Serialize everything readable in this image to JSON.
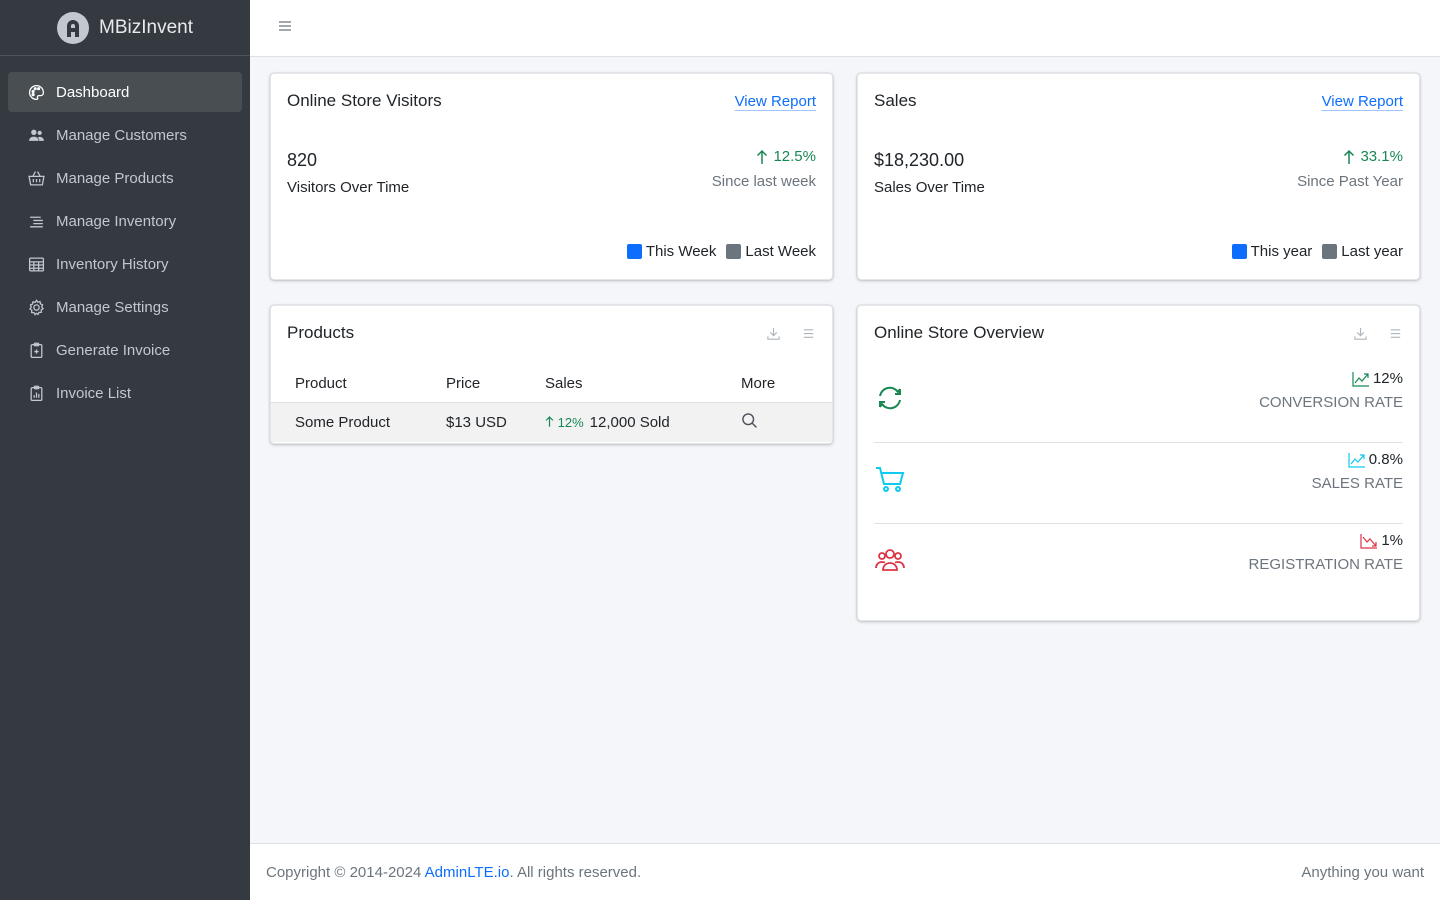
{
  "brand": {
    "name": "MBizInvent"
  },
  "sidebar": {
    "items": [
      {
        "label": "Dashboard",
        "icon": "palette-icon",
        "active": true
      },
      {
        "label": "Manage Customers",
        "icon": "people-icon"
      },
      {
        "label": "Manage Products",
        "icon": "basket-icon"
      },
      {
        "label": "Manage Inventory",
        "icon": "text-indent-icon"
      },
      {
        "label": "Inventory History",
        "icon": "table-icon"
      },
      {
        "label": "Manage Settings",
        "icon": "gear-icon"
      },
      {
        "label": "Generate Invoice",
        "icon": "clipboard-plus-icon"
      },
      {
        "label": "Invoice List",
        "icon": "clipboard-data-icon"
      }
    ]
  },
  "visitors": {
    "title": "Online Store Visitors",
    "link": "View Report",
    "value": "820",
    "label": "Visitors Over Time",
    "change": "12.5%",
    "since": "Since last week",
    "legend": [
      "This Week",
      "Last Week"
    ]
  },
  "sales": {
    "title": "Sales",
    "link": "View Report",
    "value": "$18,230.00",
    "label": "Sales Over Time",
    "change": "33.1%",
    "since": "Since Past Year",
    "legend": [
      "This year",
      "Last year"
    ]
  },
  "products": {
    "title": "Products",
    "columns": [
      "Product",
      "Price",
      "Sales",
      "More"
    ],
    "rows": [
      {
        "product": "Some Product",
        "price": "$13 USD",
        "pct": "12%",
        "sold": "12,000 Sold"
      }
    ]
  },
  "overview": {
    "title": "Online Store Overview",
    "rows": [
      {
        "value": "12%",
        "label": "CONVERSION RATE",
        "color": "#198754",
        "trend_color": "#198754"
      },
      {
        "value": "0.8%",
        "label": "SALES RATE",
        "color": "#0dcaf0",
        "trend_color": "#0dcaf0"
      },
      {
        "value": "1%",
        "label": "REGISTRATION RATE",
        "color": "#dc3545",
        "trend_color": "#dc3545"
      }
    ]
  },
  "footer": {
    "copyright": "Copyright © 2014-2024",
    "link": "AdminLTE.io",
    "rights": ". All rights reserved.",
    "right": "Anything you want"
  },
  "colors": {
    "sidebar": "#343a40",
    "primary": "#0d6efd",
    "success": "#198754"
  }
}
